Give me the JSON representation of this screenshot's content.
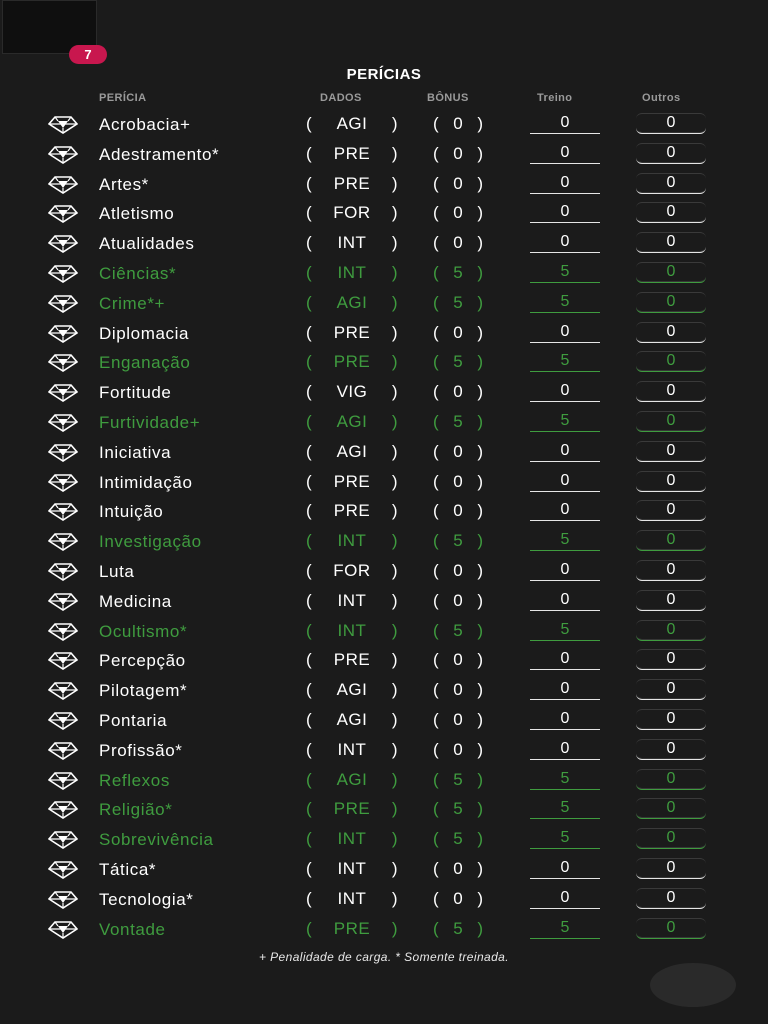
{
  "level_badge": "7",
  "title": "PERÍCIAS",
  "headers": {
    "pericia": "PERÍCIA",
    "dados": "DADOS",
    "bonus": "BÔNUS",
    "treino": "Treino",
    "outros": "Outros"
  },
  "colors": {
    "background": "#1b1b1b",
    "trained": "#3f9c3f",
    "badge": "#c8174e"
  },
  "icon": "d20-dice-icon",
  "skills": [
    {
      "name": "Acrobacia+",
      "attr": "AGI",
      "bonus": "0",
      "treino": "0",
      "outros": "0",
      "trained": false
    },
    {
      "name": "Adestramento*",
      "attr": "PRE",
      "bonus": "0",
      "treino": "0",
      "outros": "0",
      "trained": false
    },
    {
      "name": "Artes*",
      "attr": "PRE",
      "bonus": "0",
      "treino": "0",
      "outros": "0",
      "trained": false
    },
    {
      "name": "Atletismo",
      "attr": "FOR",
      "bonus": "0",
      "treino": "0",
      "outros": "0",
      "trained": false
    },
    {
      "name": "Atualidades",
      "attr": "INT",
      "bonus": "0",
      "treino": "0",
      "outros": "0",
      "trained": false
    },
    {
      "name": "Ciências*",
      "attr": "INT",
      "bonus": "5",
      "treino": "5",
      "outros": "0",
      "trained": true
    },
    {
      "name": "Crime*+",
      "attr": "AGI",
      "bonus": "5",
      "treino": "5",
      "outros": "0",
      "trained": true
    },
    {
      "name": "Diplomacia",
      "attr": "PRE",
      "bonus": "0",
      "treino": "0",
      "outros": "0",
      "trained": false
    },
    {
      "name": "Enganação",
      "attr": "PRE",
      "bonus": "5",
      "treino": "5",
      "outros": "0",
      "trained": true
    },
    {
      "name": "Fortitude",
      "attr": "VIG",
      "bonus": "0",
      "treino": "0",
      "outros": "0",
      "trained": false
    },
    {
      "name": "Furtividade+",
      "attr": "AGI",
      "bonus": "5",
      "treino": "5",
      "outros": "0",
      "trained": true
    },
    {
      "name": "Iniciativa",
      "attr": "AGI",
      "bonus": "0",
      "treino": "0",
      "outros": "0",
      "trained": false
    },
    {
      "name": "Intimidação",
      "attr": "PRE",
      "bonus": "0",
      "treino": "0",
      "outros": "0",
      "trained": false
    },
    {
      "name": "Intuição",
      "attr": "PRE",
      "bonus": "0",
      "treino": "0",
      "outros": "0",
      "trained": false
    },
    {
      "name": "Investigação",
      "attr": "INT",
      "bonus": "5",
      "treino": "5",
      "outros": "0",
      "trained": true
    },
    {
      "name": "Luta",
      "attr": "FOR",
      "bonus": "0",
      "treino": "0",
      "outros": "0",
      "trained": false
    },
    {
      "name": "Medicina",
      "attr": "INT",
      "bonus": "0",
      "treino": "0",
      "outros": "0",
      "trained": false
    },
    {
      "name": "Ocultismo*",
      "attr": "INT",
      "bonus": "5",
      "treino": "5",
      "outros": "0",
      "trained": true
    },
    {
      "name": "Percepção",
      "attr": "PRE",
      "bonus": "0",
      "treino": "0",
      "outros": "0",
      "trained": false
    },
    {
      "name": "Pilotagem*",
      "attr": "AGI",
      "bonus": "0",
      "treino": "0",
      "outros": "0",
      "trained": false
    },
    {
      "name": "Pontaria",
      "attr": "AGI",
      "bonus": "0",
      "treino": "0",
      "outros": "0",
      "trained": false
    },
    {
      "name": "Profissão*",
      "attr": "INT",
      "bonus": "0",
      "treino": "0",
      "outros": "0",
      "trained": false
    },
    {
      "name": "Reflexos",
      "attr": "AGI",
      "bonus": "5",
      "treino": "5",
      "outros": "0",
      "trained": true
    },
    {
      "name": "Religião*",
      "attr": "PRE",
      "bonus": "5",
      "treino": "5",
      "outros": "0",
      "trained": true
    },
    {
      "name": "Sobrevivência",
      "attr": "INT",
      "bonus": "5",
      "treino": "5",
      "outros": "0",
      "trained": true
    },
    {
      "name": "Tática*",
      "attr": "INT",
      "bonus": "0",
      "treino": "0",
      "outros": "0",
      "trained": false
    },
    {
      "name": "Tecnologia*",
      "attr": "INT",
      "bonus": "0",
      "treino": "0",
      "outros": "0",
      "trained": false
    },
    {
      "name": "Vontade",
      "attr": "PRE",
      "bonus": "5",
      "treino": "5",
      "outros": "0",
      "trained": true
    }
  ],
  "footnote": "+ Penalidade de carga. * Somente treinada."
}
